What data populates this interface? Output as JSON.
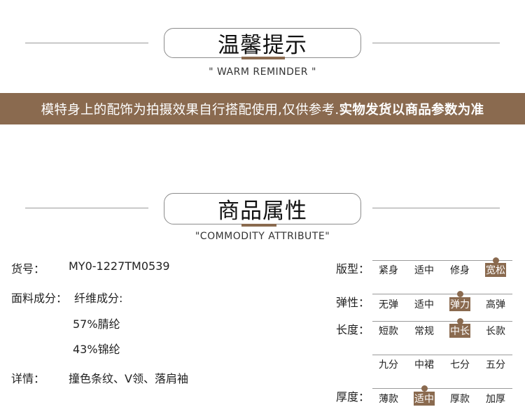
{
  "reminder": {
    "title": "温馨提示",
    "subtitle": "\" WARM REMINDER \"",
    "banner_normal": "模特身上的配饰为拍摄效果自行搭配使用,仅供参考.",
    "banner_bold": "实物发货以商品参数为准"
  },
  "attribute": {
    "title": "商品属性",
    "subtitle": "\"COMMODITY ATTRIBUTE\""
  },
  "details": {
    "sku_label": "货号：",
    "sku_value": "MY0-1227TM0539",
    "fabric_label": "面料成分：",
    "fabric_value": "纤维成分:",
    "fabric_line1": "57%腈纶",
    "fabric_line2": "43%锦纶",
    "detail_label": "详情：",
    "detail_value": "撞色条纹、V领、落肩袖"
  },
  "specs": {
    "fit": {
      "label": "版型：",
      "options": [
        "紧身",
        "适中",
        "修身",
        "宽松"
      ],
      "selected": 3
    },
    "elastic": {
      "label": "弹性：",
      "options": [
        "无弹",
        "适中",
        "弹力",
        "高弹"
      ],
      "selected": 2
    },
    "length": {
      "label": "长度：",
      "options": [
        "短款",
        "常规",
        "中长",
        "长款"
      ],
      "selected": 2
    },
    "length2": {
      "options": [
        "九分",
        "中裙",
        "七分",
        "五分"
      ]
    },
    "thickness": {
      "label": "厚度：",
      "options": [
        "薄款",
        "适中",
        "厚款",
        "加厚"
      ],
      "selected": 1
    }
  },
  "colors": {
    "accent": "#8a6a4f",
    "line": "#9a9a9a"
  }
}
